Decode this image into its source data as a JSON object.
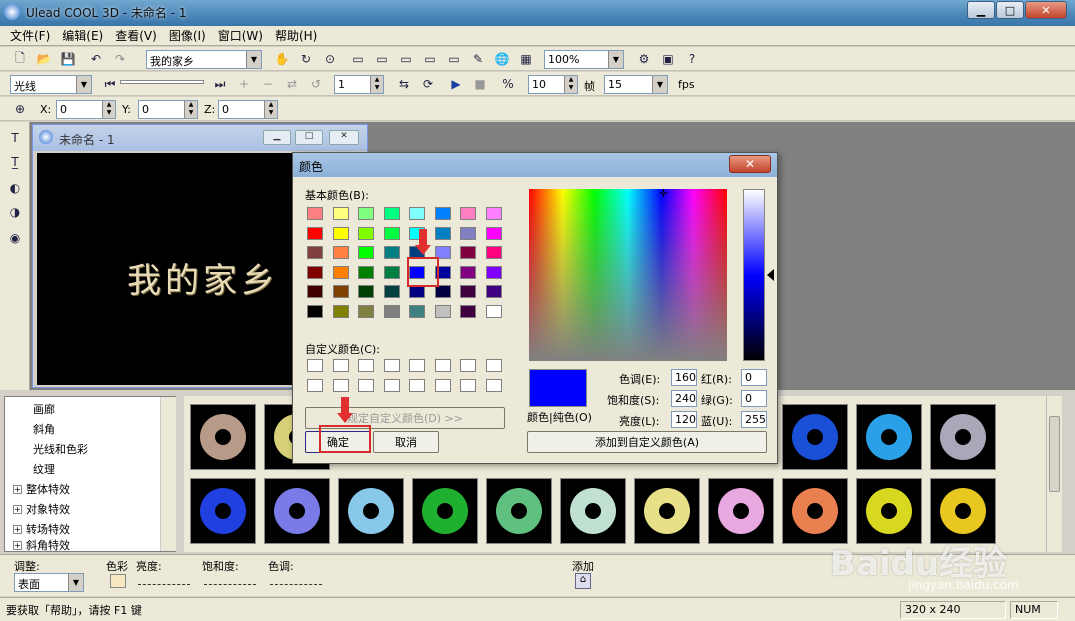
{
  "window": {
    "title": "Ulead COOL 3D - 未命名 - 1",
    "controls": {
      "minimize": "▁",
      "maximize": "□",
      "close": "✕"
    }
  },
  "menu": [
    "文件(F)",
    "编辑(E)",
    "查看(V)",
    "图像(I)",
    "窗口(W)",
    "帮助(H)"
  ],
  "toolbar1": {
    "text_object": "我的家乡",
    "zoom": "100%"
  },
  "toolbar2": {
    "light_select": "光线",
    "frame_value": "1",
    "frames_total": "10",
    "frame_label": "帧",
    "fps_value": "15",
    "fps_label": "fps"
  },
  "toolbar3": {
    "x_label": "X:",
    "x_value": "0",
    "y_label": "Y:",
    "y_value": "0",
    "z_label": "Z:",
    "z_value": "0"
  },
  "document": {
    "title": "未命名 - 1",
    "canvas_text": "我的家乡"
  },
  "tree": {
    "items": [
      {
        "label": "画廊",
        "expander": ""
      },
      {
        "label": "斜角",
        "expander": ""
      },
      {
        "label": "光线和色彩",
        "expander": ""
      },
      {
        "label": "纹理",
        "expander": ""
      },
      {
        "label": "整体特效",
        "expander": "+"
      },
      {
        "label": "对象特效",
        "expander": "+"
      },
      {
        "label": "转场特效",
        "expander": "+"
      },
      {
        "label": "斜角特效",
        "expander": "+"
      }
    ]
  },
  "thumbnails": {
    "row1": [
      "#b89a88",
      "#d8d078",
      "",
      "",
      "",
      "",
      "",
      "",
      "#1a4fd8",
      "#2aa0e8",
      "#a8a8b8"
    ],
    "row2": [
      "#2040e0",
      "#7a7ae8",
      "#88c8e8",
      "#20b030",
      "#60c080",
      "#c0e0d0",
      "#e8e088",
      "#e8a8e0",
      "#e88050",
      "#d8d820",
      "#e8c820"
    ]
  },
  "adjust": {
    "label": "调整:",
    "select": "表面",
    "color_label": "色彩",
    "brightness_label": "亮度:",
    "saturation_label": "饱和度:",
    "hue_label": "色调:",
    "add_label": "添加"
  },
  "status": {
    "help": "要获取「帮助」，请按 F1 键",
    "size": "320 x 240",
    "num": "NUM"
  },
  "dialog": {
    "title": "颜色",
    "basic_colors_label": "基本颜色(B):",
    "basic_colors": [
      "#ff8080",
      "#ffff80",
      "#80ff80",
      "#00ff80",
      "#80ffff",
      "#0080ff",
      "#ff80c0",
      "#ff80ff",
      "#ff0000",
      "#ffff00",
      "#80ff00",
      "#00ff40",
      "#00ffff",
      "#0080c0",
      "#8080c0",
      "#ff00ff",
      "#804040",
      "#ff8040",
      "#00ff00",
      "#008080",
      "#004080",
      "#8080ff",
      "#800040",
      "#ff0080",
      "#800000",
      "#ff8000",
      "#008000",
      "#008040",
      "#0000ff",
      "#0000a0",
      "#800080",
      "#8000ff",
      "#400000",
      "#804000",
      "#004000",
      "#004040",
      "#000080",
      "#000040",
      "#400040",
      "#400080",
      "#000000",
      "#808000",
      "#808040",
      "#808080",
      "#408080",
      "#c0c0c0",
      "#400040",
      "#ffffff"
    ],
    "custom_colors_label": "自定义颜色(C):",
    "define_button": "规定自定义颜色(D) >>",
    "ok_button": "确定",
    "cancel_button": "取消",
    "color_solid_label": "颜色|纯色(O)",
    "hue_label": "色调(E):",
    "hue_value": "160",
    "sat_label": "饱和度(S):",
    "sat_value": "240",
    "lum_label": "亮度(L):",
    "lum_value": "120",
    "red_label": "红(R):",
    "red_value": "0",
    "green_label": "绿(G):",
    "green_value": "0",
    "blue_label": "蓝(U):",
    "blue_value": "255",
    "add_custom_button": "添加到自定义颜色(A)",
    "current_color": "#0000ff"
  },
  "watermark": {
    "text": "Baidu经验",
    "sub": "jingyan.baidu.com"
  }
}
